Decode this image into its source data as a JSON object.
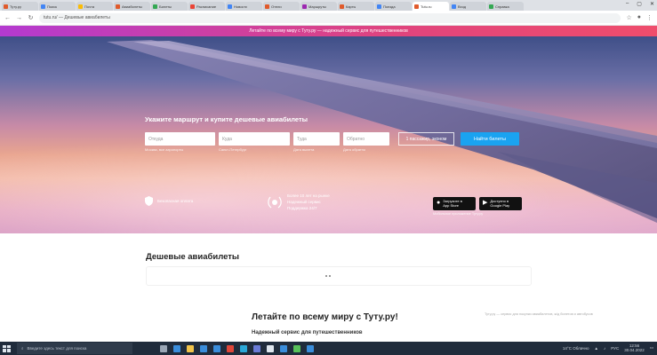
{
  "browser": {
    "tabs": [
      {
        "title": "Туту.ру",
        "color": "#e05a2b",
        "active": false
      },
      {
        "title": "Поиск",
        "color": "#4285f4",
        "active": false
      },
      {
        "title": "Почта",
        "color": "#fbbc05",
        "active": false
      },
      {
        "title": "Авиабилеты",
        "color": "#e05a2b",
        "active": false
      },
      {
        "title": "Билеты",
        "color": "#34a853",
        "active": false
      },
      {
        "title": "Расписание",
        "color": "#ea4335",
        "active": false
      },
      {
        "title": "Новости",
        "color": "#4285f4",
        "active": false
      },
      {
        "title": "Отели",
        "color": "#e05a2b",
        "active": false
      },
      {
        "title": "Маршруты",
        "color": "#9c27b0",
        "active": false
      },
      {
        "title": "Карты",
        "color": "#e05a2b",
        "active": false
      },
      {
        "title": "Поезда",
        "color": "#4285f4",
        "active": false
      },
      {
        "title": "Tutu.ru",
        "color": "#e05a2b",
        "active": true
      },
      {
        "title": "Вход",
        "color": "#4285f4",
        "active": false
      },
      {
        "title": "Справка",
        "color": "#34a853",
        "active": false
      }
    ],
    "url": "tutu.ru/ — Дешевые авиабилеты",
    "window_controls": [
      "–",
      "▢",
      "✕"
    ]
  },
  "promo": {
    "text": "Летайте по всему миру с Туту.ру — надежный сервис для путешественников"
  },
  "hero": {
    "title": "Укажите маршрут и купите дешевые авиабилеты",
    "from_placeholder": "Откуда",
    "to_placeholder": "Куда",
    "date_there_placeholder": "Туда",
    "date_back_placeholder": "Обратно",
    "passengers_label": "1 пассажир, эконом",
    "find_button": "Найти билеты",
    "hint_from": "Москва, все аэропорты",
    "hint_to": "Санкт-Петербург",
    "hint_date_there": "Дата вылета",
    "hint_date_back": "Дата обратно"
  },
  "features": {
    "safe_payment": "Безопасная оплата",
    "rating_line1": "Более 10 лет на рынке",
    "rating_line2": "Надежный сервис",
    "rating_line3": "Поддержка 24/7"
  },
  "stores": {
    "appstore_top": "Загрузите в",
    "appstore_name": "App Store",
    "googleplay_top": "Доступно в",
    "googleplay_name": "Google Play",
    "note": "Мобильное приложение Туту.ру"
  },
  "content": {
    "cheap_title": "Дешевые авиабилеты",
    "fly_title": "Летайте по всему миру с Туту.ру!",
    "fly_subtitle": "Надежный сервис для путешественников",
    "side_note": "Туту.ру — сервис для покупки авиабилетов, ж/д билетов и автобусов"
  },
  "taskbar": {
    "search_placeholder": "Введите здесь текст для поиска",
    "apps": [
      {
        "name": "task-view",
        "color": "#9aa6b5"
      },
      {
        "name": "edge",
        "color": "#3a8ddb"
      },
      {
        "name": "explorer",
        "color": "#f1c34a"
      },
      {
        "name": "store",
        "color": "#3a8ddb"
      },
      {
        "name": "mail",
        "color": "#3a8ddb"
      },
      {
        "name": "chrome",
        "color": "#e0473a"
      },
      {
        "name": "app-7",
        "color": "#2aa7d8"
      },
      {
        "name": "app-8",
        "color": "#6a7bd6"
      },
      {
        "name": "app-9",
        "color": "#dfe6ee"
      },
      {
        "name": "app-10",
        "color": "#3a8ddb"
      },
      {
        "name": "app-11",
        "color": "#58c15a"
      },
      {
        "name": "app-12",
        "color": "#3a8ddb"
      }
    ],
    "weather": "14°C Облачно",
    "lang": "РУС",
    "time": "12:56",
    "date": "30.04.2022"
  }
}
